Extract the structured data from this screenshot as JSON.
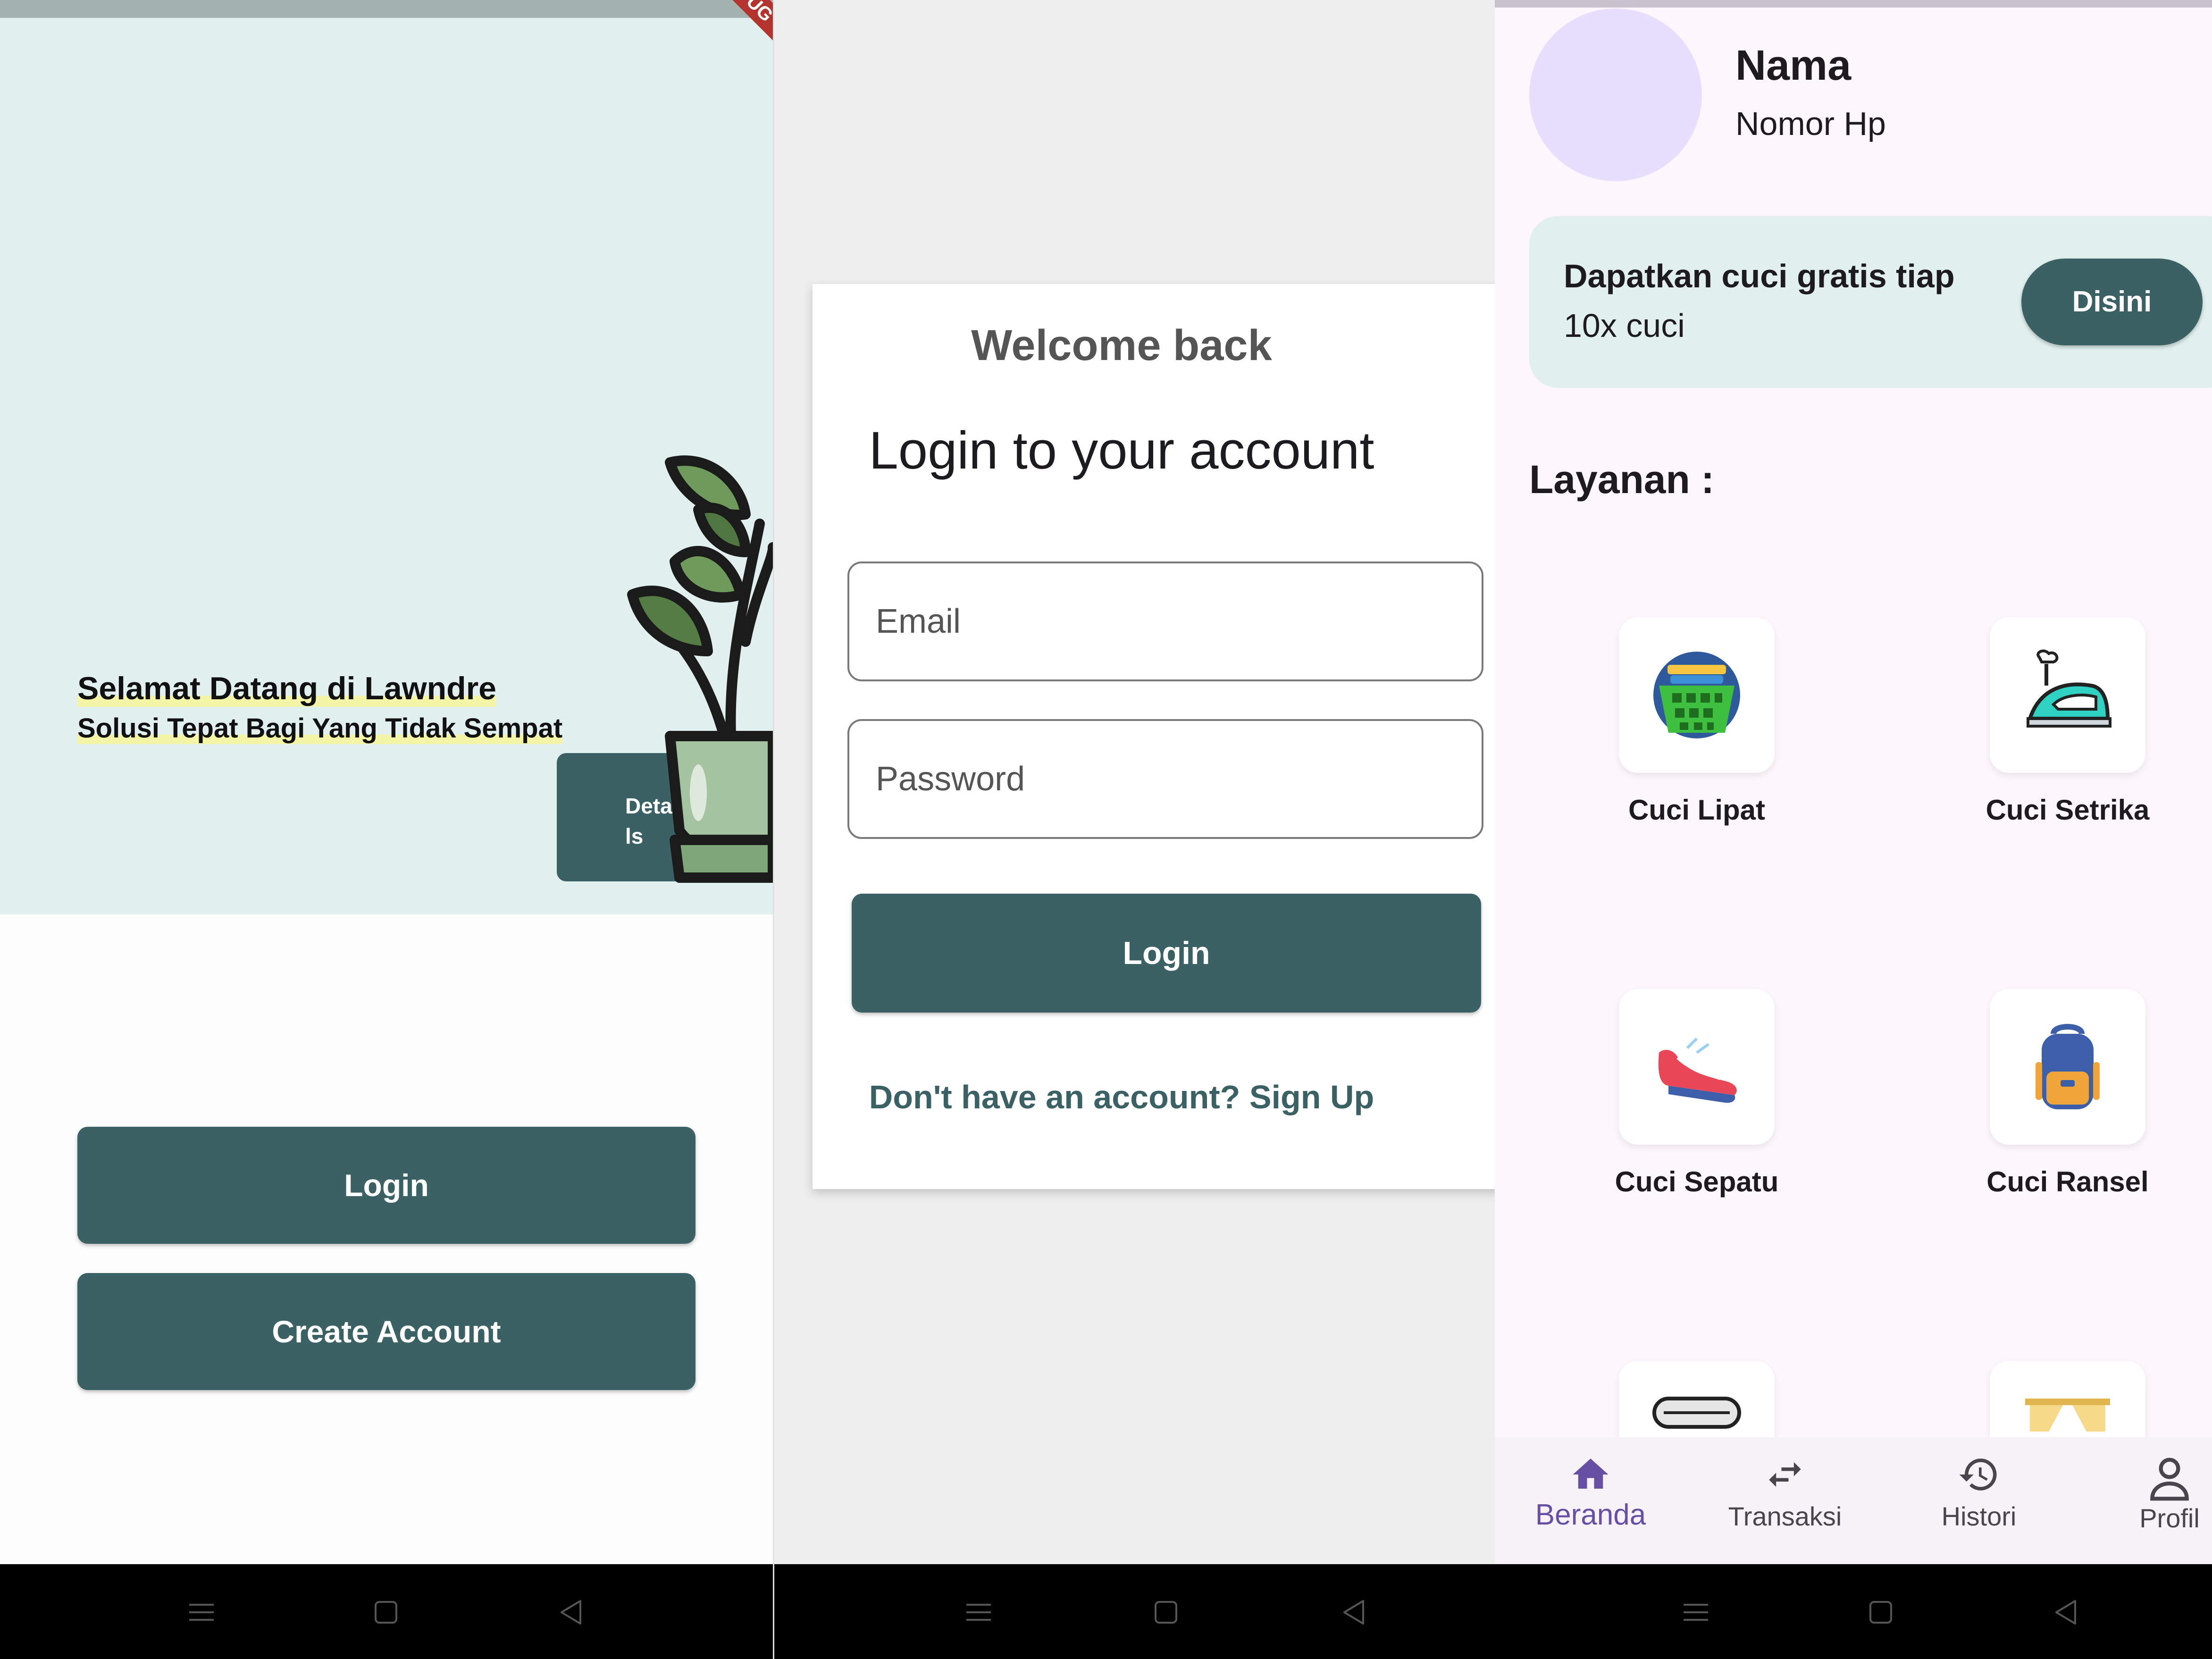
{
  "welcome_screen": {
    "hero_title": "Selamat Datang di Lawndre",
    "hero_subtitle": "Solusi Tepat Bagi Yang Tidak Sempat",
    "details_label": "Deta\nls",
    "debug_banner": "UG",
    "login_label": "Login",
    "create_account_label": "Create Account"
  },
  "login_screen": {
    "welcome": "Welcome back",
    "heading": "Login to your account",
    "email_placeholder": "Email",
    "password_placeholder": "Password",
    "login_label": "Login",
    "signup_link": "Don't have an account? Sign Up"
  },
  "home_screen": {
    "profile_name": "Nama",
    "profile_phone": "Nomor Hp",
    "promo_line1": "Dapatkan cuci gratis tiap",
    "promo_line2": "10x cuci",
    "promo_button": "Disini",
    "services_title": "Layanan :",
    "services": [
      {
        "label": "Cuci Lipat",
        "icon": "laundry-basket-icon"
      },
      {
        "label": "Cuci Setrika",
        "icon": "iron-icon"
      },
      {
        "label": "Cuci Sepatu",
        "icon": "sneaker-icon"
      },
      {
        "label": "Cuci Ransel",
        "icon": "backpack-icon"
      }
    ],
    "bottom_nav": [
      {
        "label": "Beranda",
        "icon": "home-icon",
        "active": true
      },
      {
        "label": "Transaksi",
        "icon": "swap-arrows-icon",
        "active": false
      },
      {
        "label": "Histori",
        "icon": "history-icon",
        "active": false
      },
      {
        "label": "Profil",
        "icon": "person-icon",
        "active": false
      }
    ]
  },
  "colors": {
    "primary": "#3b6164",
    "hero_bg": "#e1f0ee",
    "nav_active": "#6750a4",
    "avatar": "#e8defd"
  }
}
